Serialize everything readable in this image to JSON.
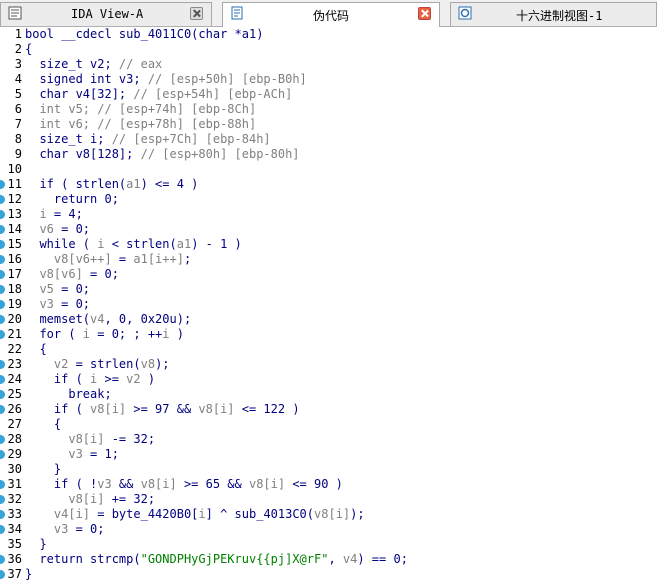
{
  "tabs": [
    {
      "label": "IDA View-A",
      "icon": "document-grid-icon",
      "active": false
    },
    {
      "label": "伪代码",
      "icon": "pseudocode-page-icon",
      "active": true
    },
    {
      "label": "十六进制视图-1",
      "icon": "hex-circle-icon",
      "active": false
    }
  ],
  "code_lines": [
    {
      "n": "1",
      "dot": false,
      "parts": [
        [
          "k",
          "bool __cdecl sub_4011C0(char *a1)"
        ]
      ]
    },
    {
      "n": "2",
      "dot": false,
      "parts": [
        [
          "k",
          "{"
        ]
      ]
    },
    {
      "n": "3",
      "dot": false,
      "parts": [
        [
          "k",
          "  size_t v2; "
        ],
        [
          "c",
          "// eax"
        ]
      ]
    },
    {
      "n": "4",
      "dot": false,
      "parts": [
        [
          "k",
          "  signed int v3; "
        ],
        [
          "c",
          "// [esp+50h] [ebp-B0h]"
        ]
      ]
    },
    {
      "n": "5",
      "dot": false,
      "parts": [
        [
          "k",
          "  char v4[32]; "
        ],
        [
          "c",
          "// [esp+54h] [ebp-ACh]"
        ]
      ]
    },
    {
      "n": "6",
      "dot": false,
      "parts": [
        [
          "c",
          "  int v5; // [esp+74h] [ebp-8Ch]"
        ]
      ]
    },
    {
      "n": "7",
      "dot": false,
      "parts": [
        [
          "c",
          "  int v6; // [esp+78h] [ebp-88h]"
        ]
      ]
    },
    {
      "n": "8",
      "dot": false,
      "parts": [
        [
          "k",
          "  size_t i; "
        ],
        [
          "c",
          "// [esp+7Ch] [ebp-84h]"
        ]
      ]
    },
    {
      "n": "9",
      "dot": false,
      "parts": [
        [
          "k",
          "  char v8[128]; "
        ],
        [
          "c",
          "// [esp+80h] [ebp-80h]"
        ]
      ]
    },
    {
      "n": "10",
      "dot": false,
      "parts": [
        [
          "k",
          ""
        ]
      ]
    },
    {
      "n": "11",
      "dot": true,
      "parts": [
        [
          "k",
          "  if ( strlen("
        ],
        [
          "g",
          "a1"
        ],
        [
          "k",
          ") <= 4 )"
        ]
      ]
    },
    {
      "n": "12",
      "dot": true,
      "parts": [
        [
          "k",
          "    return 0;"
        ]
      ]
    },
    {
      "n": "13",
      "dot": true,
      "parts": [
        [
          "g",
          "  i"
        ],
        [
          "k",
          " = 4;"
        ]
      ]
    },
    {
      "n": "14",
      "dot": true,
      "parts": [
        [
          "g",
          "  v6"
        ],
        [
          "k",
          " = 0;"
        ]
      ]
    },
    {
      "n": "15",
      "dot": true,
      "parts": [
        [
          "k",
          "  while ( "
        ],
        [
          "g",
          "i"
        ],
        [
          "k",
          " < strlen("
        ],
        [
          "g",
          "a1"
        ],
        [
          "k",
          ") - 1 )"
        ]
      ]
    },
    {
      "n": "16",
      "dot": true,
      "parts": [
        [
          "g",
          "    v8[v6++]"
        ],
        [
          "k",
          " = "
        ],
        [
          "g",
          "a1[i++]"
        ],
        [
          "k",
          ";"
        ]
      ]
    },
    {
      "n": "17",
      "dot": true,
      "parts": [
        [
          "g",
          "  v8[v6]"
        ],
        [
          "k",
          " = 0;"
        ]
      ]
    },
    {
      "n": "18",
      "dot": true,
      "parts": [
        [
          "g",
          "  v5"
        ],
        [
          "k",
          " = 0;"
        ]
      ]
    },
    {
      "n": "19",
      "dot": true,
      "parts": [
        [
          "g",
          "  v3"
        ],
        [
          "k",
          " = 0;"
        ]
      ]
    },
    {
      "n": "20",
      "dot": true,
      "parts": [
        [
          "k",
          "  memset("
        ],
        [
          "g",
          "v4"
        ],
        [
          "k",
          ", 0, 0x20u);"
        ]
      ]
    },
    {
      "n": "21",
      "dot": true,
      "parts": [
        [
          "k",
          "  for ( "
        ],
        [
          "g",
          "i"
        ],
        [
          "k",
          " = 0; ; ++"
        ],
        [
          "g",
          "i"
        ],
        [
          "k",
          " )"
        ]
      ]
    },
    {
      "n": "22",
      "dot": false,
      "parts": [
        [
          "k",
          "  {"
        ]
      ]
    },
    {
      "n": "23",
      "dot": true,
      "parts": [
        [
          "g",
          "    v2"
        ],
        [
          "k",
          " = strlen("
        ],
        [
          "g",
          "v8"
        ],
        [
          "k",
          ");"
        ]
      ]
    },
    {
      "n": "24",
      "dot": true,
      "parts": [
        [
          "k",
          "    if ( "
        ],
        [
          "g",
          "i"
        ],
        [
          "k",
          " >= "
        ],
        [
          "g",
          "v2"
        ],
        [
          "k",
          " )"
        ]
      ]
    },
    {
      "n": "25",
      "dot": true,
      "parts": [
        [
          "k",
          "      break;"
        ]
      ]
    },
    {
      "n": "26",
      "dot": true,
      "parts": [
        [
          "k",
          "    if ( "
        ],
        [
          "g",
          "v8[i]"
        ],
        [
          "k",
          " >= 97 && "
        ],
        [
          "g",
          "v8[i]"
        ],
        [
          "k",
          " <= 122 )"
        ]
      ]
    },
    {
      "n": "27",
      "dot": false,
      "parts": [
        [
          "k",
          "    {"
        ]
      ]
    },
    {
      "n": "28",
      "dot": true,
      "parts": [
        [
          "g",
          "      v8[i]"
        ],
        [
          "k",
          " -= 32;"
        ]
      ]
    },
    {
      "n": "29",
      "dot": true,
      "parts": [
        [
          "g",
          "      v3"
        ],
        [
          "k",
          " = 1;"
        ]
      ]
    },
    {
      "n": "30",
      "dot": false,
      "parts": [
        [
          "k",
          "    }"
        ]
      ]
    },
    {
      "n": "31",
      "dot": true,
      "parts": [
        [
          "k",
          "    if ( !"
        ],
        [
          "g",
          "v3"
        ],
        [
          "k",
          " && "
        ],
        [
          "g",
          "v8[i]"
        ],
        [
          "k",
          " >= 65 && "
        ],
        [
          "g",
          "v8[i]"
        ],
        [
          "k",
          " <= 90 )"
        ]
      ]
    },
    {
      "n": "32",
      "dot": true,
      "parts": [
        [
          "g",
          "      v8[i]"
        ],
        [
          "k",
          " += 32;"
        ]
      ]
    },
    {
      "n": "33",
      "dot": true,
      "parts": [
        [
          "g",
          "    v4[i]"
        ],
        [
          "k",
          " = byte_4420B0["
        ],
        [
          "g",
          "i"
        ],
        [
          "k",
          "] ^ sub_4013C0("
        ],
        [
          "g",
          "v8[i]"
        ],
        [
          "k",
          ");"
        ]
      ]
    },
    {
      "n": "34",
      "dot": true,
      "parts": [
        [
          "g",
          "    v3"
        ],
        [
          "k",
          " = 0;"
        ]
      ]
    },
    {
      "n": "35",
      "dot": false,
      "parts": [
        [
          "k",
          "  }"
        ]
      ]
    },
    {
      "n": "36",
      "dot": true,
      "parts": [
        [
          "k",
          "  return strcmp("
        ],
        [
          "s",
          "\"GONDPHyGjPEKruv{{pj]X@rF\""
        ],
        [
          "k",
          ", "
        ],
        [
          "g",
          "v4"
        ],
        [
          "k",
          ") == 0;"
        ]
      ]
    },
    {
      "n": "37",
      "dot": true,
      "parts": [
        [
          "k",
          "}"
        ]
      ]
    }
  ]
}
